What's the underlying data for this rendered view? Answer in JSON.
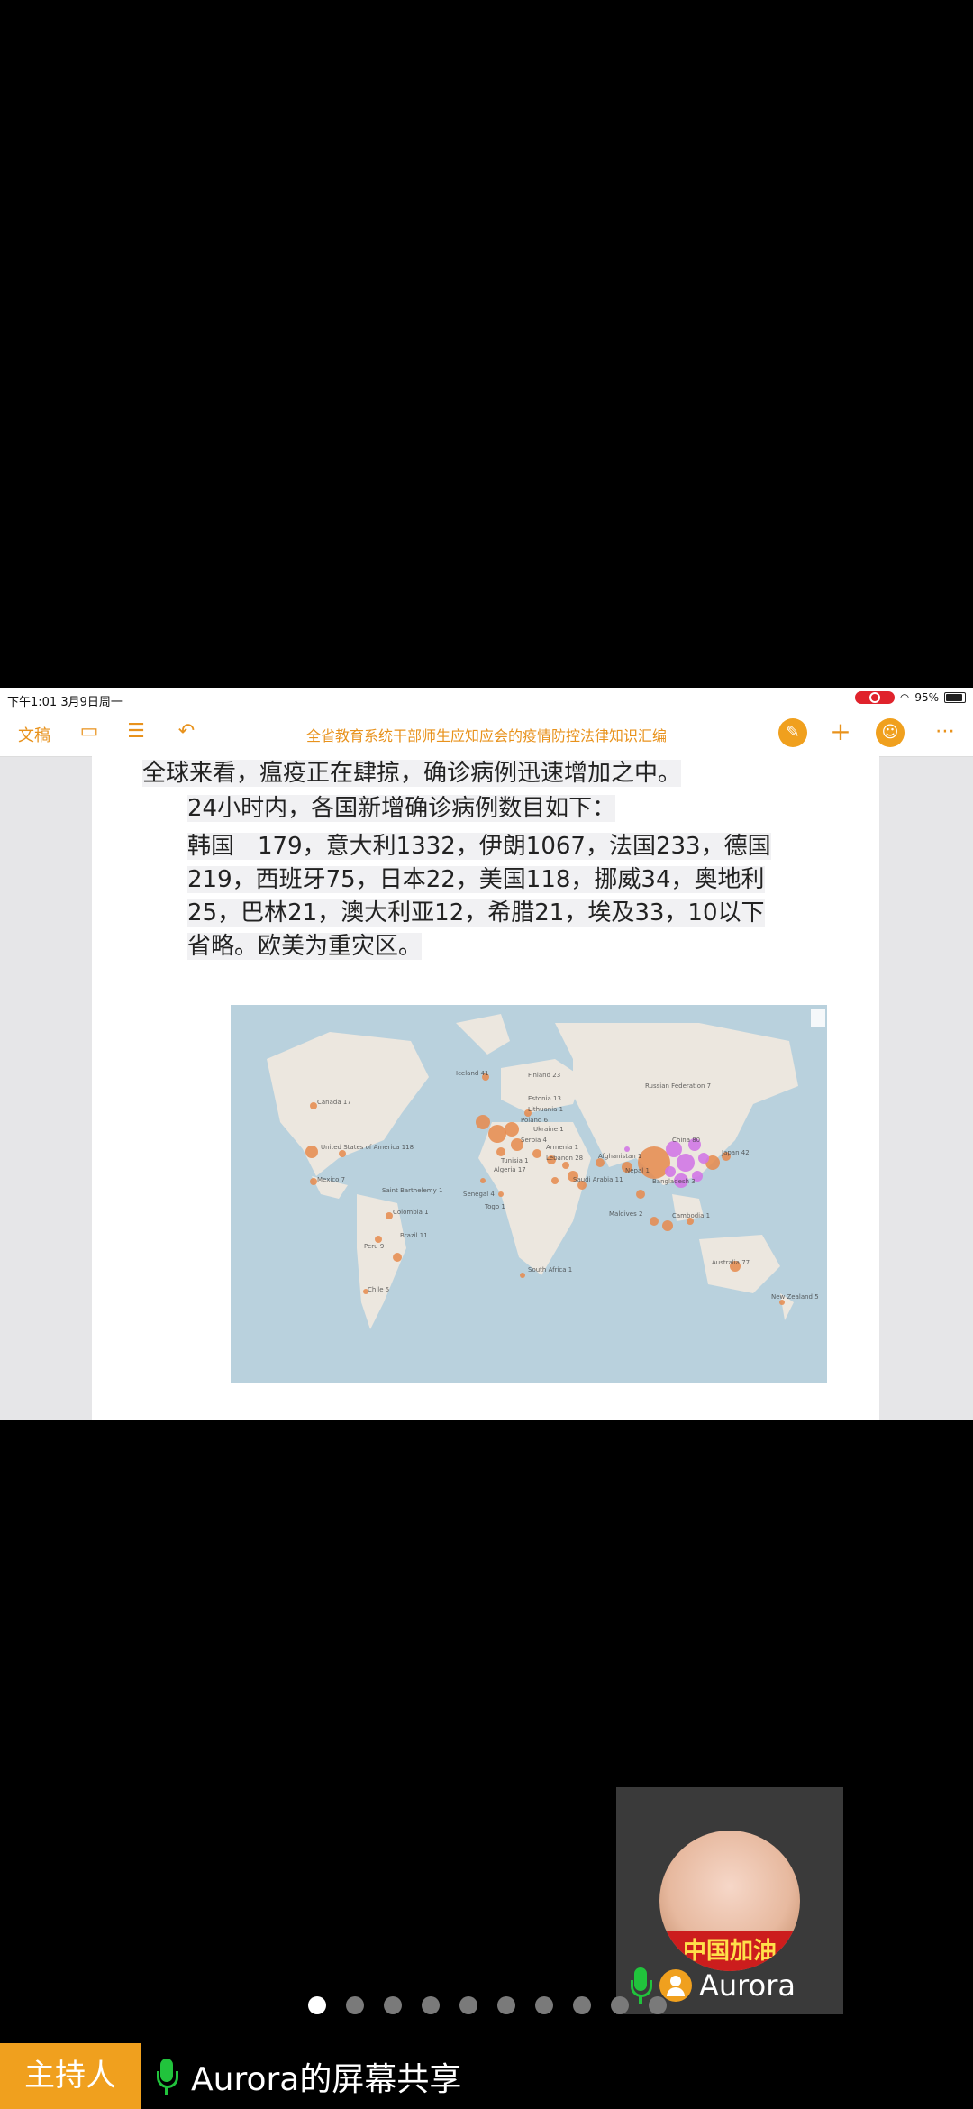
{
  "status_bar": {
    "time": "下午1:01  3月9日周一",
    "battery": "95%"
  },
  "toolbar": {
    "doc_label": "文稿",
    "title": "全省教育系统干部师生应知应会的疫情防控法律知识汇编"
  },
  "document": {
    "para1": "全球来看，瘟疫正在肆掠，确诊病例迅速增加之中。",
    "para2": "24小时内，各国新增确诊病例数目如下：",
    "para3": "韩国　179，意大利1332，伊朗1067，法国233，德国219，西班牙75，日本22，美国118，挪威34，奥地利25，巴林21，澳大利亚12，希腊21，埃及33，10以下省略。欧美为重灾区。"
  },
  "map": {
    "labels": [
      "Canada 17",
      "United States of America 118",
      "Mexico 7",
      "Saint Barthelemy 1",
      "Colombia 1",
      "Peru 9",
      "Brazil 11",
      "Chile 5",
      "Iceland 41",
      "Finland 23",
      "Estonia 13",
      "Lithuania 1",
      "Poland 6",
      "Ukraine 1",
      "Serbia 4",
      "Armenia 1",
      "Lebanon 28",
      "Afghanistan 1",
      "Senegal 4",
      "Togo 1",
      "Algeria 17",
      "Tunisia 1",
      "Saudi Arabia 11",
      "Nepal 1",
      "Bangladesh 3",
      "Maldives 2",
      "Cambodia 1",
      "South Africa 1",
      "Australia 77",
      "New Zealand 5",
      "Russian Federation 7",
      "China 80",
      "Japan 42"
    ]
  },
  "participant": {
    "name": "Aurora",
    "banner": "中国加油"
  },
  "footer": {
    "host_label": "主持人",
    "share_label": "Aurora的屏幕共享"
  },
  "pager": {
    "count": 10,
    "active": 1
  },
  "colors": {
    "accent": "#f0a01e",
    "mic": "#21c33c",
    "record": "#e0232c"
  }
}
